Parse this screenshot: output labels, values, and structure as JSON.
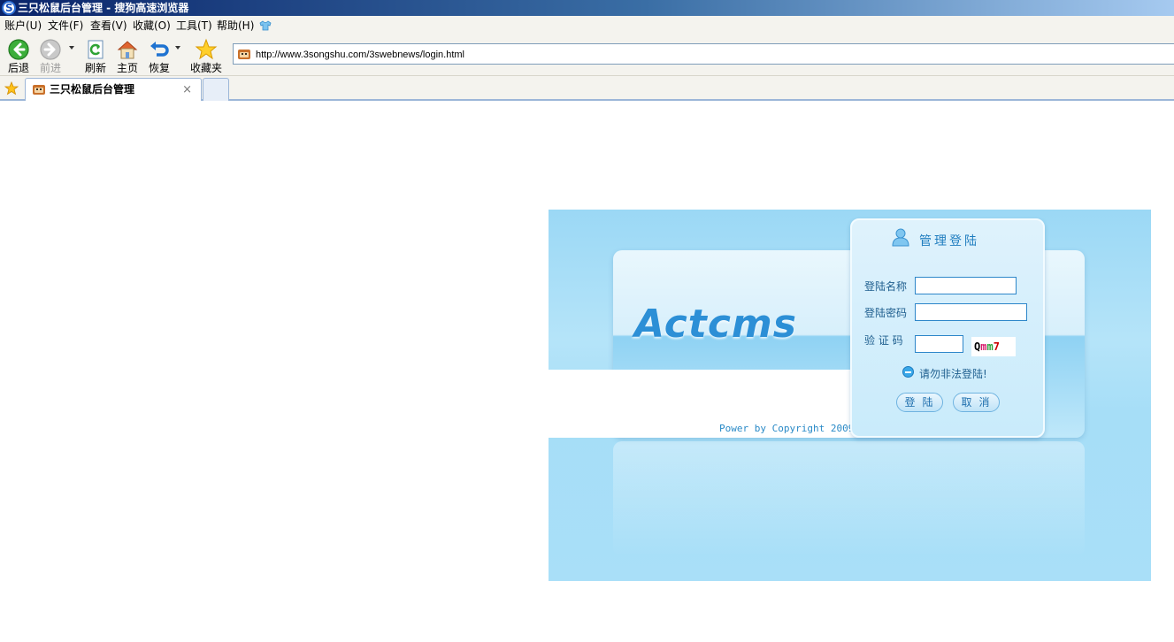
{
  "window": {
    "title": "三只松鼠后台管理 - 搜狗高速浏览器",
    "app_icon": "sogou-browser-icon"
  },
  "menu": [
    "账户(U)",
    "文件(F)",
    "查看(V)",
    "收藏(O)",
    "工具(T)",
    "帮助(H)"
  ],
  "toolbar": {
    "back": "后退",
    "forward": "前进",
    "refresh": "刷新",
    "home": "主页",
    "restore": "恢复",
    "favorites": "收藏夹"
  },
  "address": {
    "url": "http://www.3songshu.com/3swebnews/login.html"
  },
  "tabs": [
    {
      "title": "三只松鼠后台管理",
      "close": "×"
    }
  ],
  "login": {
    "logo": "Actcms",
    "header": "管理登陆",
    "username_label": "登陆名称",
    "password_label": "登陆密码",
    "captcha_label": "验 证 码",
    "captcha": {
      "c1": "Q",
      "c2": "m",
      "c3": "m",
      "c4": "7"
    },
    "notice": "请勿非法登陆!",
    "login_button": "登陆",
    "cancel_button": "取消",
    "powered": "Power by Copyright 2009"
  },
  "colors": {
    "accent": "#2c8fd6",
    "panel_bg": "#a6def7",
    "title_bar": "#0a246a"
  }
}
